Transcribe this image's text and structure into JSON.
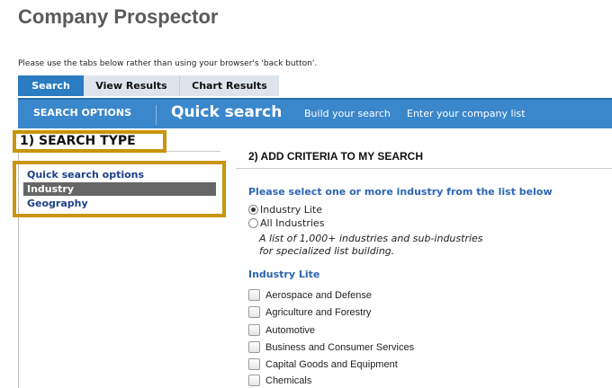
{
  "header": {
    "title": "Company Prospector",
    "hint": "Please use the tabs below rather than using your browser's 'back button'."
  },
  "tabs": [
    "Search",
    "View Results",
    "Chart Results"
  ],
  "option_bar": {
    "search_options": "SEARCH OPTIONS",
    "quick_search": "Quick search",
    "build": "Build your search",
    "enter": "Enter your company list"
  },
  "left": {
    "section_title": "1) SEARCH TYPE",
    "menu": [
      "Quick search options",
      "Industry",
      "Geography"
    ]
  },
  "right": {
    "section_title": "2) ADD CRITERIA TO MY SEARCH",
    "instruction": "Please select one or more industry from the list below",
    "radios": [
      {
        "label": "Industry Lite",
        "selected": true
      },
      {
        "label": "All Industries",
        "selected": false
      }
    ],
    "description_lines": [
      "A list of 1,000+ industries and sub-industries",
      "for specialized list building."
    ],
    "list_title": "Industry Lite",
    "industries": [
      "Aerospace and Defense",
      "Agriculture and Forestry",
      "Automotive",
      "Business and Consumer Services",
      "Capital Goods and Equipment",
      "Chemicals"
    ]
  },
  "colors": {
    "accent_blue": "#3a87cc",
    "highlight_gold": "#c9950c",
    "link_blue": "#2d66b5"
  }
}
